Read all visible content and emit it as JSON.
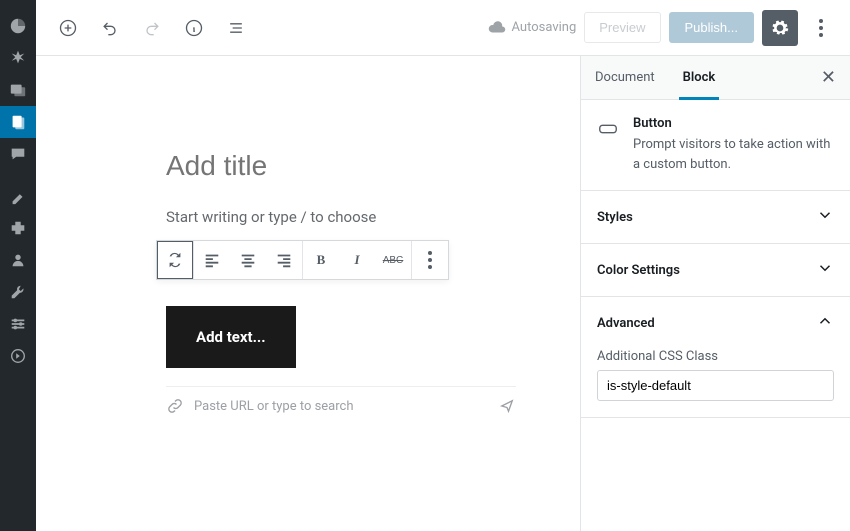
{
  "topbar": {
    "autosave_label": "Autosaving",
    "preview_label": "Preview",
    "publish_label": "Publish..."
  },
  "editor": {
    "title_placeholder": "Add title",
    "prompt_text": "Start writing or type / to choose",
    "button_block_text": "Add text...",
    "url_placeholder": "Paste URL or type to search",
    "toolbar_strike": "ABC"
  },
  "inspector": {
    "tabs": {
      "document": "Document",
      "block": "Block"
    },
    "block": {
      "title": "Button",
      "description": "Prompt visitors to take action with a custom button."
    },
    "panels": {
      "styles": "Styles",
      "color": "Color Settings",
      "advanced": "Advanced"
    },
    "advanced": {
      "field_label": "Additional CSS Class",
      "value": "is-style-default"
    }
  }
}
